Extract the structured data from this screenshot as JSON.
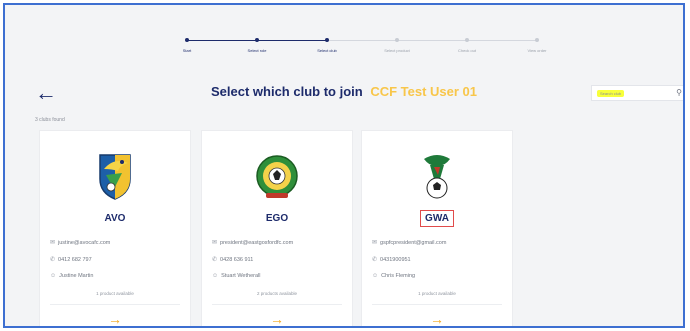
{
  "stepper": {
    "steps": [
      {
        "label": "Start",
        "state": "done"
      },
      {
        "label": "Select role",
        "state": "done"
      },
      {
        "label": "Select club",
        "state": "current"
      },
      {
        "label": "Select product",
        "state": "todo"
      },
      {
        "label": "Check out",
        "state": "todo"
      },
      {
        "label": "View order",
        "state": "todo"
      }
    ]
  },
  "header": {
    "back_icon": "arrow-left-icon",
    "title": "Select which club to join",
    "user": "CCF Test User 01"
  },
  "search": {
    "placeholder": "Search club",
    "icon": "search-icon"
  },
  "results": {
    "count_text": "3 clubs found"
  },
  "clubs": [
    {
      "name": "AVO",
      "email": "justine@avocafc.com",
      "phone": "0412 682 797",
      "contact": "Justine Martin",
      "availability": "1 product available"
    },
    {
      "name": "EGO",
      "email": "president@eastgosfordfc.com",
      "phone": "0428 636 911",
      "contact": "Stuart Wetherall",
      "availability": "2 products available"
    },
    {
      "name": "GWA",
      "email": "gspfcpresident@gmail.com",
      "phone": "0431900951",
      "contact": "Chris Fleming",
      "availability": "1 product available"
    }
  ],
  "colors": {
    "brand_navy": "#1d2b6b",
    "accent_gold": "#f8c64a",
    "arrow_orange": "#f3a81c",
    "highlight_yellow": "#f7ff3b",
    "annotation_red": "#e14b4b"
  }
}
